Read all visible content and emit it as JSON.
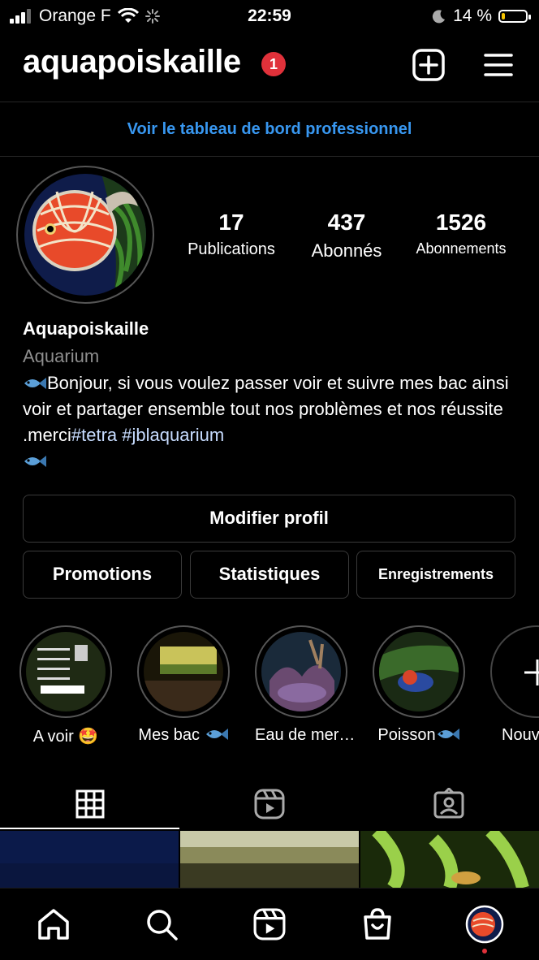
{
  "status_bar": {
    "carrier": "Orange F",
    "time": "22:59",
    "battery": "14 %",
    "battery_level": 0.14
  },
  "header": {
    "username": "aquapoiskaille",
    "notification_count": "1"
  },
  "dashboard_link": "Voir le tableau de bord professionnel",
  "stats": [
    {
      "value": "17",
      "label": "Publications"
    },
    {
      "value": "437",
      "label": "Abonnés"
    },
    {
      "value": "1526",
      "label": "Abonnements"
    }
  ],
  "profile": {
    "name": "Aquapoiskaille",
    "category": "Aquarium",
    "bio_text": "Bonjour, si vous voulez passer voir et suivre mes bac ainsi voir et partager ensemble tout nos problèmes et nos réussite .merci",
    "hashtags": [
      "#tetra",
      "#jblaquarium"
    ]
  },
  "buttons": {
    "edit_profile": "Modifier profil",
    "promotions": "Promotions",
    "insights": "Statistiques",
    "saved": "Enregistrements"
  },
  "highlights": [
    {
      "label": "A voir 🤩"
    },
    {
      "label": "Mes bac"
    },
    {
      "label": "Eau de mer…"
    },
    {
      "label": "Poisson"
    },
    {
      "label": "Nouv"
    }
  ],
  "colors": {
    "accent_blue": "#3897f0",
    "notification_red": "#e0313a",
    "battery_yellow": "#f5c400",
    "hashtag": "#c7dcff"
  },
  "tabs": [
    "grid-icon",
    "reels-icon",
    "tagged-icon"
  ],
  "bottom_nav": [
    "home-icon",
    "search-icon",
    "reels-icon",
    "shop-icon",
    "profile-avatar"
  ]
}
